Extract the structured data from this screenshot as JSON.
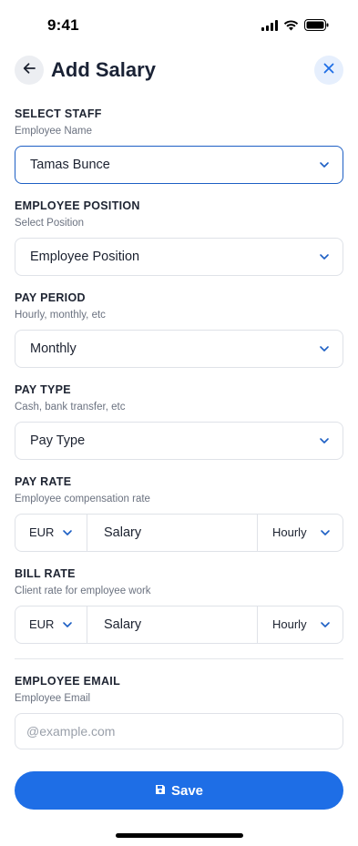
{
  "status": {
    "time": "9:41"
  },
  "header": {
    "title": "Add Salary"
  },
  "colors": {
    "accent": "#1e6ee6",
    "active_border": "#1d5fc4",
    "close_bg": "#e6effd"
  },
  "fields": {
    "staff": {
      "label": "SELECT STAFF",
      "hint": "Employee Name",
      "value": "Tamas Bunce"
    },
    "position": {
      "label": "EMPLOYEE POSITION",
      "hint": "Select Position",
      "value": "Employee Position"
    },
    "pay_period": {
      "label": "PAY PERIOD",
      "hint": "Hourly, monthly, etc",
      "value": "Monthly"
    },
    "pay_type": {
      "label": "PAY TYPE",
      "hint": "Cash, bank transfer, etc",
      "value": "Pay Type"
    },
    "pay_rate": {
      "label": "PAY RATE",
      "hint": "Employee compensation rate",
      "currency": "EUR",
      "amount": "Salary",
      "period": "Hourly"
    },
    "bill_rate": {
      "label": "BILL RATE",
      "hint": "Client rate for employee work",
      "currency": "EUR",
      "amount": "Salary",
      "period": "Hourly"
    },
    "email": {
      "label": "EMPLOYEE EMAIL",
      "hint": "Employee Email",
      "placeholder": "@example.com"
    }
  },
  "actions": {
    "save_label": "Save"
  },
  "icons": [
    "back-arrow-icon",
    "close-icon",
    "chevron-down-icon",
    "save-icon",
    "signal-icon",
    "wifi-icon",
    "battery-icon"
  ]
}
